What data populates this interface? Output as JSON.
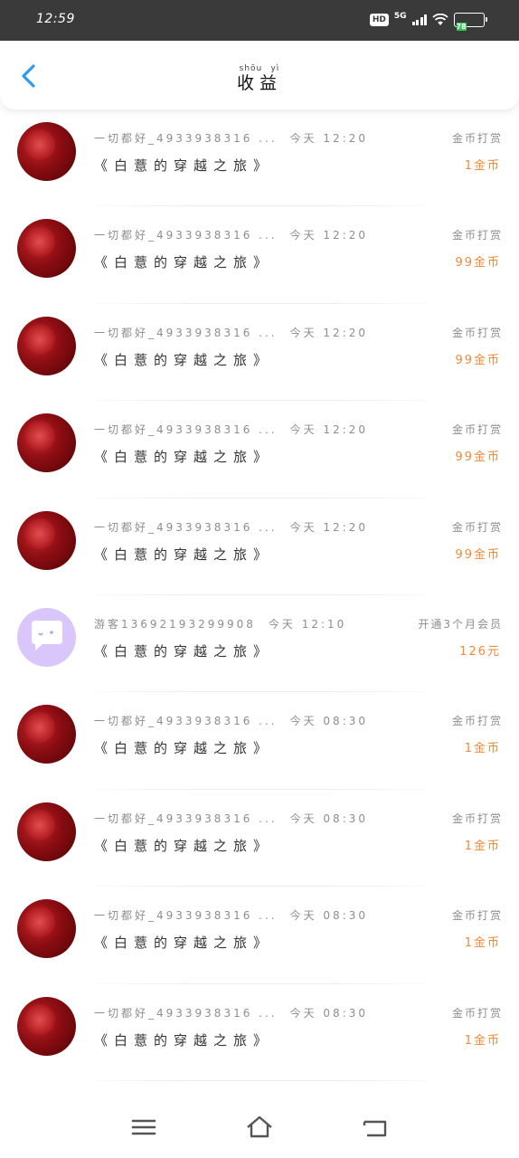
{
  "status_bar": {
    "time": "12:59",
    "hd": "HD",
    "network": "5G",
    "battery": "78",
    "battery_color": "#34c759"
  },
  "header": {
    "back_icon": "chevron-left-icon",
    "title": "收益",
    "title_pinyin": "shōu yì",
    "accent": "#2e9bf0"
  },
  "rows": [
    {
      "avatar": "red",
      "name": "一切都好_4933938316 ...",
      "time": "今天 12:20",
      "book": "《白薏的穿越之旅》",
      "action": "金币打赏",
      "amount": "1金币"
    },
    {
      "avatar": "red",
      "name": "一切都好_4933938316 ...",
      "time": "今天 12:20",
      "book": "《白薏的穿越之旅》",
      "action": "金币打赏",
      "amount": "99金币"
    },
    {
      "avatar": "red",
      "name": "一切都好_4933938316 ...",
      "time": "今天 12:20",
      "book": "《白薏的穿越之旅》",
      "action": "金币打赏",
      "amount": "99金币"
    },
    {
      "avatar": "red",
      "name": "一切都好_4933938316 ...",
      "time": "今天 12:20",
      "book": "《白薏的穿越之旅》",
      "action": "金币打赏",
      "amount": "99金币"
    },
    {
      "avatar": "red",
      "name": "一切都好_4933938316 ...",
      "time": "今天 12:20",
      "book": "《白薏的穿越之旅》",
      "action": "金币打赏",
      "amount": "99金币"
    },
    {
      "avatar": "purple",
      "name": "游客13692193299908",
      "time": "今天 12:10",
      "book": "《白薏的穿越之旅》",
      "action": "开通3个月会员",
      "amount": "126元"
    },
    {
      "avatar": "red",
      "name": "一切都好_4933938316 ...",
      "time": "今天 08:30",
      "book": "《白薏的穿越之旅》",
      "action": "金币打赏",
      "amount": "1金币"
    },
    {
      "avatar": "red",
      "name": "一切都好_4933938316 ...",
      "time": "今天 08:30",
      "book": "《白薏的穿越之旅》",
      "action": "金币打赏",
      "amount": "1金币"
    },
    {
      "avatar": "red",
      "name": "一切都好_4933938316 ...",
      "time": "今天 08:30",
      "book": "《白薏的穿越之旅》",
      "action": "金币打赏",
      "amount": "1金币"
    },
    {
      "avatar": "red",
      "name": "一切都好_4933938316 ...",
      "time": "今天 08:30",
      "book": "《白薏的穿越之旅》",
      "action": "金币打赏",
      "amount": "1金币"
    }
  ],
  "amount_color": "#f08a3a",
  "navbar": {
    "menu_icon": "menu-icon",
    "home_icon": "home-icon",
    "back_icon": "back-icon"
  }
}
